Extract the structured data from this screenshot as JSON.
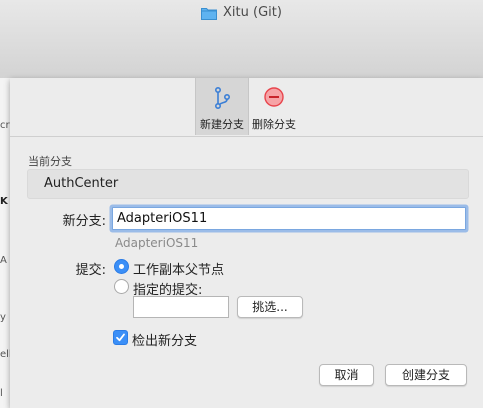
{
  "window": {
    "title": "Xitu (Git)",
    "icon": "folder-icon"
  },
  "background_fragments": [
    "cri",
    "K",
    "A",
    "y",
    "ell",
    "l"
  ],
  "toolbar": {
    "items": [
      {
        "label": "新建分支",
        "icon": "branch-icon",
        "selected": true
      },
      {
        "label": "删除分支",
        "icon": "minus-circle-icon",
        "selected": false
      }
    ]
  },
  "current_branch": {
    "label": "当前分支",
    "value": "AuthCenter"
  },
  "new_branch": {
    "label": "新分支:",
    "value": "AdapteriOS11",
    "hint": "AdapteriOS11"
  },
  "commit": {
    "label": "提交:",
    "options": [
      {
        "label": "工作副本父节点",
        "selected": true
      },
      {
        "label": "指定的提交:",
        "selected": false
      }
    ],
    "specified_value": "",
    "pick_button": "挑选..."
  },
  "checkout": {
    "label": "检出新分支",
    "checked": true
  },
  "buttons": {
    "cancel": "取消",
    "create": "创建分支"
  },
  "colors": {
    "accent": "#3b8ff7",
    "delete_red": "#e8454d"
  }
}
